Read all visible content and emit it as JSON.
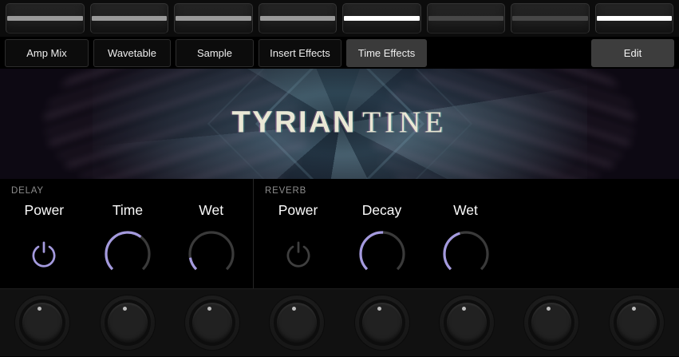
{
  "colors": {
    "accent": "#a49ade",
    "knob-track": "#3a3a3a",
    "slider-mid": "#9a9a9a",
    "slider-bright": "#ffffff",
    "slider-dim": "#474747"
  },
  "top_sliders": {
    "items": [
      {
        "id": 1,
        "level": "mid"
      },
      {
        "id": 2,
        "level": "mid"
      },
      {
        "id": 3,
        "level": "mid"
      },
      {
        "id": 4,
        "level": "mid"
      },
      {
        "id": 5,
        "level": "bright"
      },
      {
        "id": 6,
        "level": "dim"
      },
      {
        "id": 7,
        "level": "dim"
      },
      {
        "id": 8,
        "level": "bright"
      }
    ]
  },
  "tabs": {
    "items": [
      {
        "label": "Amp Mix",
        "selected": false
      },
      {
        "label": "Wavetable",
        "selected": false
      },
      {
        "label": "Sample",
        "selected": false
      },
      {
        "label": "Insert Effects",
        "selected": false
      },
      {
        "label": "Time Effects",
        "selected": true
      }
    ],
    "edit_label": "Edit"
  },
  "banner": {
    "title_primary": "TYRIAN",
    "title_secondary": "TINE"
  },
  "effects": {
    "delay": {
      "section_label": "DELAY",
      "power": {
        "label": "Power",
        "on": true
      },
      "knobs": [
        {
          "label": "Time",
          "value_pct": 64
        },
        {
          "label": "Wet",
          "value_pct": 13
        }
      ]
    },
    "reverb": {
      "section_label": "REVERB",
      "power": {
        "label": "Power",
        "on": false
      },
      "knobs": [
        {
          "label": "Decay",
          "value_pct": 51
        },
        {
          "label": "Wet",
          "value_pct": 44
        }
      ]
    }
  },
  "hardware_knobs": {
    "count": 8
  }
}
